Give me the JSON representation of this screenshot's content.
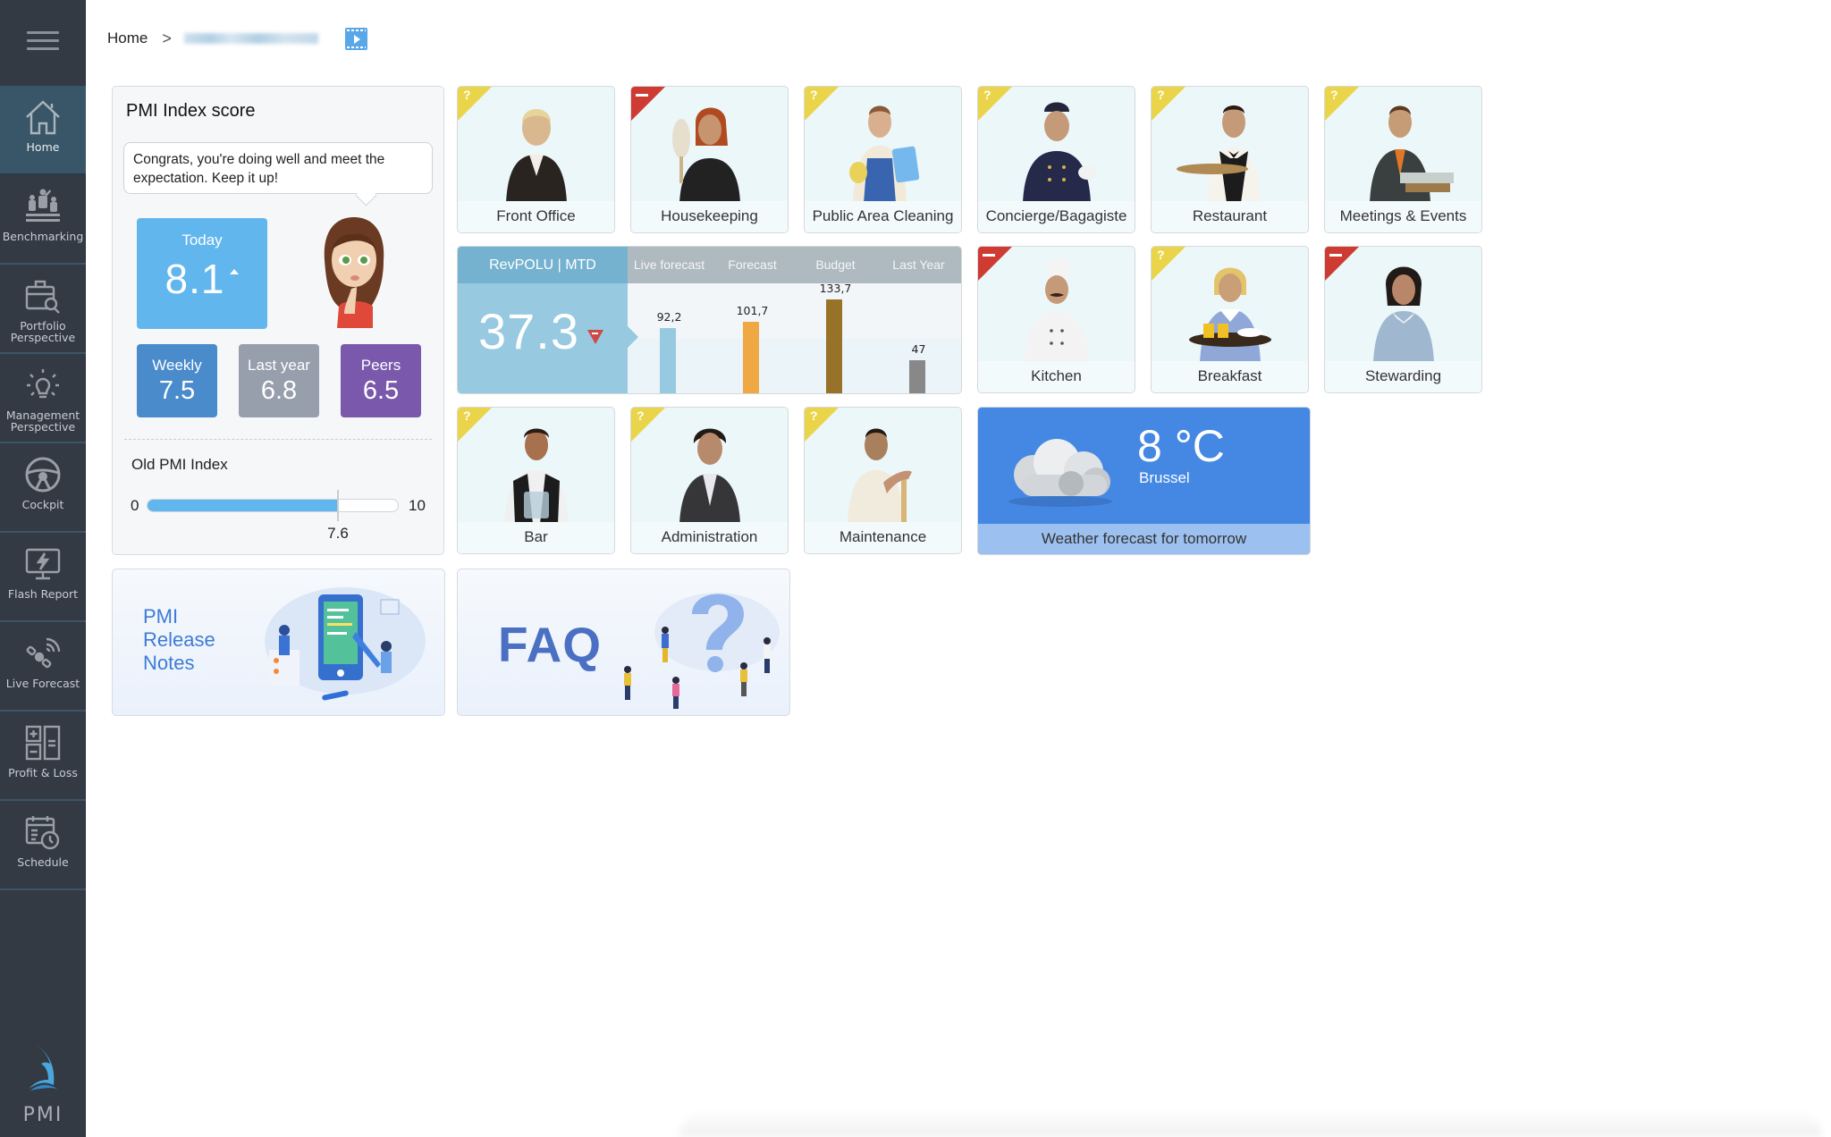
{
  "sidebar": {
    "menu_icon": "hamburger-menu-icon",
    "items": [
      {
        "label": "Home",
        "icon": "home-icon",
        "active": true
      },
      {
        "label": "Benchmarking",
        "icon": "podium-people-icon",
        "active": false
      },
      {
        "label": "Portfolio Perspective",
        "icon": "briefcase-search-icon",
        "active": false
      },
      {
        "label": "Management Perspective",
        "icon": "lightbulb-icon",
        "active": false
      },
      {
        "label": "Cockpit",
        "icon": "steering-wheel-icon",
        "active": false
      },
      {
        "label": "Flash Report",
        "icon": "monitor-lightning-icon",
        "active": false
      },
      {
        "label": "Live Forecast",
        "icon": "satellite-icon",
        "active": false
      },
      {
        "label": "Profit & Loss",
        "icon": "calculator-icon",
        "active": false
      },
      {
        "label": "Schedule",
        "icon": "calendar-clock-icon",
        "active": false
      }
    ],
    "brand": "PMI"
  },
  "breadcrumb": {
    "home": "Home",
    "separator": ">",
    "current": "[redacted hotel name]",
    "video_icon": "video-icon"
  },
  "pmi_index": {
    "title": "PMI Index score",
    "message": "Congrats, you're doing well and meet the expectation. Keep it up!",
    "today": {
      "label": "Today",
      "value": "8.1",
      "trend": "up"
    },
    "weekly": {
      "label": "Weekly",
      "value": "7.5"
    },
    "last_year": {
      "label": "Last year",
      "value": "6.8"
    },
    "peers": {
      "label": "Peers",
      "value": "6.5"
    },
    "colors": {
      "today": "#62b6ee",
      "weekly": "#4a8bcb",
      "last_year": "#979eac",
      "peers": "#7a59ad"
    },
    "old_index": {
      "label": "Old PMI Index",
      "min": "0",
      "max": "10",
      "value": "7.6",
      "fraction": 0.76
    }
  },
  "departments": [
    {
      "label": "Front Office",
      "status": "warning",
      "flag": "?"
    },
    {
      "label": "Housekeeping",
      "status": "negative",
      "flag": "-"
    },
    {
      "label": "Public Area Cleaning",
      "status": "warning",
      "flag": "?"
    },
    {
      "label": "Concierge/Bagagiste",
      "status": "warning",
      "flag": "?"
    },
    {
      "label": "Restaurant",
      "status": "warning",
      "flag": "?"
    },
    {
      "label": "Meetings & Events",
      "status": "warning",
      "flag": "?"
    },
    {
      "label": "Kitchen",
      "status": "negative",
      "flag": "-"
    },
    {
      "label": "Breakfast",
      "status": "warning",
      "flag": "?"
    },
    {
      "label": "Stewarding",
      "status": "negative",
      "flag": "-"
    },
    {
      "label": "Bar",
      "status": "warning",
      "flag": "?"
    },
    {
      "label": "Administration",
      "status": "warning",
      "flag": "?"
    },
    {
      "label": "Maintenance",
      "status": "warning",
      "flag": "?"
    }
  ],
  "revpolu": {
    "title": "RevPOLU | MTD",
    "value": "37.3",
    "trend": "down",
    "chart_data": {
      "type": "bar",
      "categories": [
        "Live forecast",
        "Forecast",
        "Budget",
        "Last Year"
      ],
      "values": [
        92.2,
        101.7,
        133.7,
        47
      ],
      "labels": [
        "92,2",
        "101,7",
        "133,7",
        "47"
      ],
      "colors": [
        "#97c9e0",
        "#f0a844",
        "#99722a",
        "#888888"
      ],
      "ylim": [
        0,
        150
      ]
    }
  },
  "weather": {
    "temperature": "8 °C",
    "city": "Brussel",
    "caption": "Weather forecast for tomorrow",
    "icon": "cloud-icon"
  },
  "promos": {
    "release_notes": [
      "PMI",
      "Release",
      "Notes"
    ],
    "faq": "FAQ"
  }
}
